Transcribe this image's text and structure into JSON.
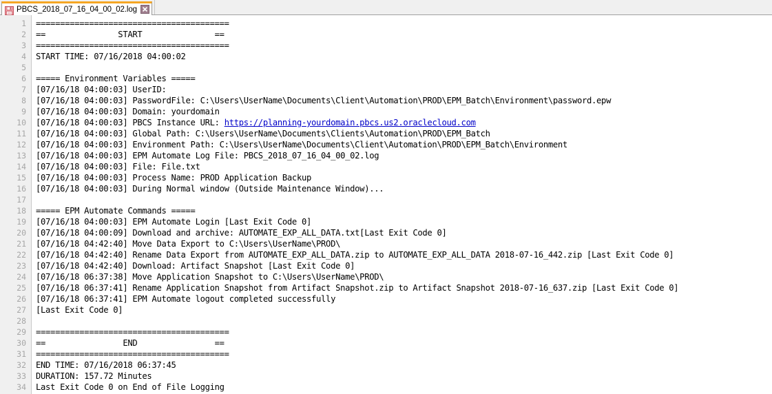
{
  "window": {
    "title": "PBCS_2018_07_16_04_00_02.log"
  },
  "tab": {
    "label": "PBCS_2018_07_16_04_00_02.log",
    "icon": "save-floppy-icon",
    "close_icon": "close-icon",
    "accent_color": "#f5a623",
    "close_bg_color": "#a07f8f"
  },
  "editor": {
    "link_color": "#0000c8",
    "gutter_bg": "#f0f0f0",
    "line_number_color": "#a6a6a6",
    "lines": [
      {
        "n": "1",
        "text": "========================================"
      },
      {
        "n": "2",
        "text": "==               START               =="
      },
      {
        "n": "3",
        "text": "========================================"
      },
      {
        "n": "4",
        "text": "START TIME: 07/16/2018 04:00:02"
      },
      {
        "n": "5",
        "text": ""
      },
      {
        "n": "6",
        "text": "===== Environment Variables ====="
      },
      {
        "n": "7",
        "text": "[07/16/18 04:00:03] UserID:"
      },
      {
        "n": "8",
        "text": "[07/16/18 04:00:03] PasswordFile: C:\\Users\\UserName\\Documents\\Client\\Automation\\PROD\\EPM_Batch\\Environment\\password.epw"
      },
      {
        "n": "9",
        "text": "[07/16/18 04:00:03] Domain: yourdomain"
      },
      {
        "n": "10",
        "text": "[07/16/18 04:00:03] PBCS Instance URL: ",
        "link": "https://planning-yourdomain.pbcs.us2.oraclecloud.com"
      },
      {
        "n": "11",
        "text": "[07/16/18 04:00:03] Global Path: C:\\Users\\UserName\\Documents\\Clients\\Automation\\PROD\\EPM_Batch"
      },
      {
        "n": "12",
        "text": "[07/16/18 04:00:03] Environment Path: C:\\Users\\UserName\\Documents\\Client\\Automation\\PROD\\EPM_Batch\\Environment"
      },
      {
        "n": "13",
        "text": "[07/16/18 04:00:03] EPM Automate Log File: PBCS_2018_07_16_04_00_02.log"
      },
      {
        "n": "14",
        "text": "[07/16/18 04:00:03] File: File.txt"
      },
      {
        "n": "15",
        "text": "[07/16/18 04:00:03] Process Name: PROD Application Backup"
      },
      {
        "n": "16",
        "text": "[07/16/18 04:00:03] During Normal window (Outside Maintenance Window)..."
      },
      {
        "n": "17",
        "text": ""
      },
      {
        "n": "18",
        "text": "===== EPM Automate Commands ====="
      },
      {
        "n": "19",
        "text": "[07/16/18 04:00:03] EPM Automate Login [Last Exit Code 0]"
      },
      {
        "n": "20",
        "text": "[07/16/18 04:00:09] Download and archive: AUTOMATE_EXP_ALL_DATA.txt[Last Exit Code 0]"
      },
      {
        "n": "21",
        "text": "[07/16/18 04:42:40] Move Data Export to C:\\Users\\UserName\\PROD\\"
      },
      {
        "n": "22",
        "text": "[07/16/18 04:42:40] Rename Data Export from AUTOMATE_EXP_ALL_DATA.zip to AUTOMATE_EXP_ALL_DATA 2018-07-16_442.zip [Last Exit Code 0]"
      },
      {
        "n": "23",
        "text": "[07/16/18 04:42:40] Download: Artifact Snapshot [Last Exit Code 0]"
      },
      {
        "n": "24",
        "text": "[07/16/18 06:37:38] Move Application Snapshot to C:\\Users\\UserName\\PROD\\"
      },
      {
        "n": "25",
        "text": "[07/16/18 06:37:41] Rename Application Snapshot from Artifact Snapshot.zip to Artifact Snapshot 2018-07-16_637.zip [Last Exit Code 0]"
      },
      {
        "n": "26",
        "text": "[07/16/18 06:37:41] EPM Automate logout completed successfully"
      },
      {
        "n": "27",
        "text": "[Last Exit Code 0]"
      },
      {
        "n": "28",
        "text": ""
      },
      {
        "n": "29",
        "text": "========================================"
      },
      {
        "n": "30",
        "text": "==                END                =="
      },
      {
        "n": "31",
        "text": "========================================"
      },
      {
        "n": "32",
        "text": "END TIME: 07/16/2018 06:37:45"
      },
      {
        "n": "33",
        "text": "DURATION: 157.72 Minutes"
      },
      {
        "n": "34",
        "text": "Last Exit Code 0 on End of File Logging"
      }
    ]
  }
}
